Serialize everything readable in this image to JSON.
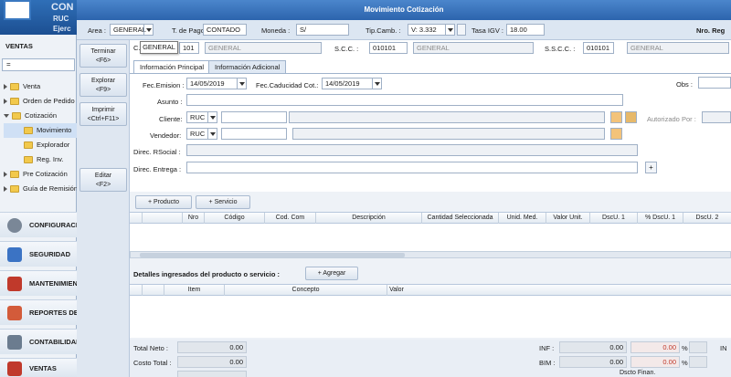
{
  "app": {
    "logo_co": "CON",
    "logo_ruc": "RUC",
    "logo_ej": "Ejerc"
  },
  "sidebar": {
    "section_title": "VENTAS",
    "search_value": "=",
    "tree": [
      {
        "label": "Venta",
        "level": 0,
        "expanded": false
      },
      {
        "label": "Orden de Pedido",
        "level": 0,
        "expanded": false
      },
      {
        "label": "Cotización",
        "level": 0,
        "expanded": true
      },
      {
        "label": "Movimiento",
        "level": 1,
        "expanded": false
      },
      {
        "label": "Explorador",
        "level": 1,
        "expanded": false
      },
      {
        "label": "Reg. Inv.",
        "level": 1,
        "expanded": false
      },
      {
        "label": "Pre Cotización",
        "level": 0,
        "expanded": false
      },
      {
        "label": "Guía de Remisión",
        "level": 0,
        "expanded": false
      }
    ],
    "nav": [
      {
        "label": "CONFIGURACIÓN",
        "icon": "gear-icon",
        "color": "#7a8797"
      },
      {
        "label": "SEGURIDAD",
        "icon": "lock-icon",
        "color": "#3b73c4"
      },
      {
        "label": "MANTENIMIENTO",
        "icon": "tools-icon",
        "color": "#c0392b"
      },
      {
        "label": "REPORTES DE",
        "icon": "report-icon",
        "color": "#d35b3a"
      },
      {
        "label": "CONTABILIDAD",
        "icon": "ledger-icon",
        "color": "#6b7c8f"
      },
      {
        "label": "VENTAS",
        "icon": "cash-icon",
        "color": "#c0392b"
      }
    ]
  },
  "window": {
    "title": "Movimiento Cotización"
  },
  "topbar": {
    "area_label": "Area :",
    "area_value": "GENERAL",
    "tpago_label": "T. de Pago :",
    "tpago_value": "CONTADO",
    "moneda_label": "Moneda :",
    "moneda_value": "S/",
    "tipcamb_label": "Tip.Camb. :",
    "tipcamb_value": "V: 3.332",
    "tasaigv_label": "Tasa IGV :",
    "tasaigv_value": "18.00",
    "nroreg_label": "Nro. Reg"
  },
  "tooltip": "GENERAL",
  "row2": {
    "c_label": "C.",
    "c_value": "101",
    "c_desc": "GENERAL",
    "scc_label": "S.C.C. :",
    "scc_value": "010101",
    "scc_desc": "GENERAL",
    "sscc_label": "S.S.C.C. :",
    "sscc_value": "010101",
    "sscc_desc": "GENERAL"
  },
  "commands": [
    {
      "label": "Terminar",
      "key": "<F6>"
    },
    {
      "label": "Explorar",
      "key": "<F9>"
    },
    {
      "label": "Imprimir",
      "key": "<Ctrl+F11>"
    },
    {
      "label": "Editar",
      "key": "<F2>"
    }
  ],
  "tabs": [
    "Información Principal",
    "Información Adicional"
  ],
  "form": {
    "fec_emision_label": "Fec.Emision :",
    "fec_emision": "14/05/2019",
    "fec_caducidad_label": "Fec.Caducidad Cot.:",
    "fec_caducidad": "14/05/2019",
    "obs_label": "Obs :",
    "asunto_label": "Asunto :",
    "cliente_label": "Cliente:",
    "cliente_tipo": "RUC",
    "autorizado_label": "Autorizado Por :",
    "vendedor_label": "Vendedor:",
    "vendedor_tipo": "RUC",
    "direc_rsocial_label": "Direc. RSocial :",
    "direc_entrega_label": "Direc. Entrega :",
    "plus_label": "+"
  },
  "grid_buttons": {
    "producto": "+ Producto",
    "servicio": "+ Servicio"
  },
  "grid_columns": [
    "Nro",
    "Código",
    "Cod. Com",
    "Descripción",
    "Cantidad Seleccionada",
    "Unid. Med.",
    "Valor Unit.",
    "DscU. 1",
    "% DscU. 1",
    "DscU. 2"
  ],
  "details": {
    "title": "Detalles ingresados del producto o servicio :",
    "agregar": "+ Agregar",
    "columns": [
      "Item",
      "Concepto",
      "Valor"
    ]
  },
  "totals": {
    "total_neto_label": "Total Neto :",
    "total_neto": "0.00",
    "costo_total_label": "Costo Total :",
    "costo_total": "0.00",
    "inf_label": "INF :",
    "inf_value": "0.00",
    "inf_red": "0.00",
    "inf_pct": "%",
    "inf_tail": "IN",
    "bim_label": "BIM :",
    "bim_value": "0.00",
    "bim_red": "0.00",
    "bim_pct": "%",
    "dscto_label": "Dscto Finan."
  }
}
